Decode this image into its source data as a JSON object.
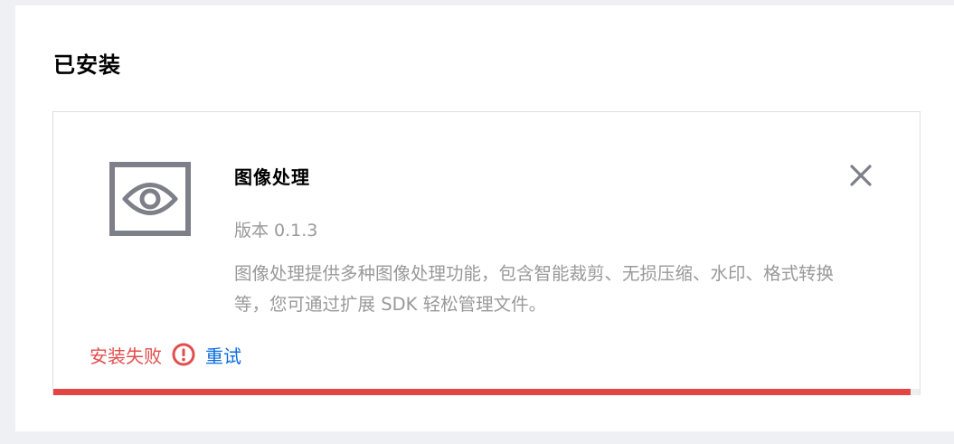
{
  "section": {
    "title": "已安装"
  },
  "plugin": {
    "name": "图像处理",
    "version": "版本 0.1.3",
    "description": "图像处理提供多种图像处理功能，包含智能裁剪、无损压缩、水印、格式转换等，您可通过扩展 SDK 轻松管理文件。",
    "icon": "eye-icon",
    "close_icon": "close-icon"
  },
  "status": {
    "text": "安装失败",
    "icon": "exclamation-circle-icon",
    "retry_label": "重试",
    "progress": 0.99
  },
  "colors": {
    "error": "#e34d4d",
    "link": "#0a6cdf",
    "icon_gray": "#7d8089",
    "muted_text": "#999999"
  }
}
